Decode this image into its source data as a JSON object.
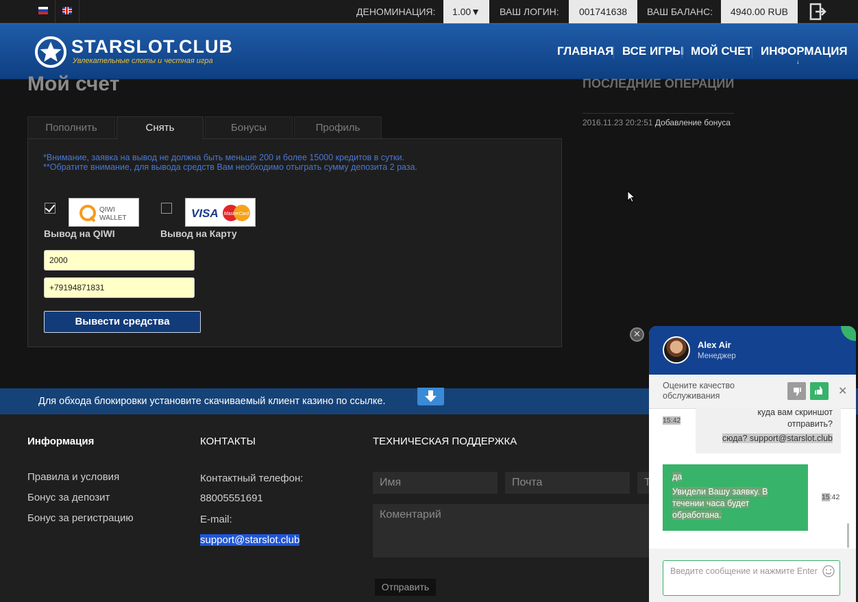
{
  "topbar": {
    "denomination_label": "ДЕНОМИНАЦИЯ:",
    "denomination_value": "1.00▼",
    "login_label": "ВАШ ЛОГИН:",
    "login_value": "001741638",
    "balance_label": "ВАШ БАЛАНС:",
    "balance_value": "4940.00 RUB"
  },
  "header": {
    "logo": "STARSLOT.CLUB",
    "tagline": "Увлекательные слоты и честная игра",
    "nav": [
      "ГЛАВНАЯ",
      "ВСЕ ИГРЫ",
      "МОЙ СЧЕТ",
      "ИНФОРМАЦИЯ"
    ]
  },
  "page": {
    "title": "Мой счет",
    "recent_title": "ПОСЛЕДНИЕ ОПЕРАЦИИ",
    "recent_ops": [
      {
        "date": "2016.11.23 20:2:51",
        "text": "Добавление бонуса"
      }
    ]
  },
  "tabs": [
    "Пополнить",
    "Снять",
    "Бонусы",
    "Профиль"
  ],
  "withdraw": {
    "notice1": "*Внимание, заявка на вывод не должна быть меньше 200 и более 15000 кредитов в сутки.",
    "notice2": "**Обратите внимание, для вывода средств Вам необходимо отыграть сумму депозита 2 раза.",
    "methods": [
      {
        "label": "Вывод на QIWI",
        "logo": "QIWI WALLET",
        "checked": true
      },
      {
        "label": "Вывод на Карту",
        "logo": "VISA MasterCard",
        "checked": false
      }
    ],
    "qiwi_logo_l1": "QIWI",
    "qiwi_logo_l2": "WALLET",
    "visa_text": "VISA",
    "mc_text": "MasterCard",
    "amount": "2000",
    "phone": "+79194871831",
    "submit": "Вывести средства"
  },
  "banner": {
    "text": "Для обхода блокировки установите скачиваемый клиент казино по ссылке."
  },
  "footer": {
    "info_title": "Информация",
    "info_links": [
      "Правила и условия",
      "Бонус за депозит",
      "Бонус за регистрацию"
    ],
    "contacts_title": "КОНТАКТЫ",
    "phone_label": "Контактный телефон:",
    "phone": "88005551691",
    "email_label": "E-mail:",
    "email": "support@starslot.club",
    "support_title": "ТЕХНИЧЕСКАЯ ПОДДЕРЖКА",
    "name_placeholder": "Имя",
    "mail_placeholder": "Почта",
    "third_placeholder": "Т",
    "comment_placeholder": "Коментарий",
    "send": "Отправить"
  },
  "chat": {
    "agent_name": "Alex Air",
    "agent_role": "Менеджер",
    "rate_text": "Оцените качество обслуживания",
    "messages": [
      {
        "time": "15:42",
        "lines": [
          "куда вам скриншот",
          "отправить?",
          "сюда? support@starslot.club"
        ]
      },
      {
        "time_hl": "15",
        "time_rest": ":42",
        "lines": [
          "да",
          "Увидели Вашу заявку. В",
          "течении часа будет",
          "обработана."
        ]
      }
    ],
    "input_placeholder": "Введите сообщение и нажмите Enter"
  },
  "colors": {
    "header_blue": "#134a8e",
    "accent_green": "#37b36a",
    "banner_blue": "#164377",
    "field_yellow": "#ffffc8"
  }
}
